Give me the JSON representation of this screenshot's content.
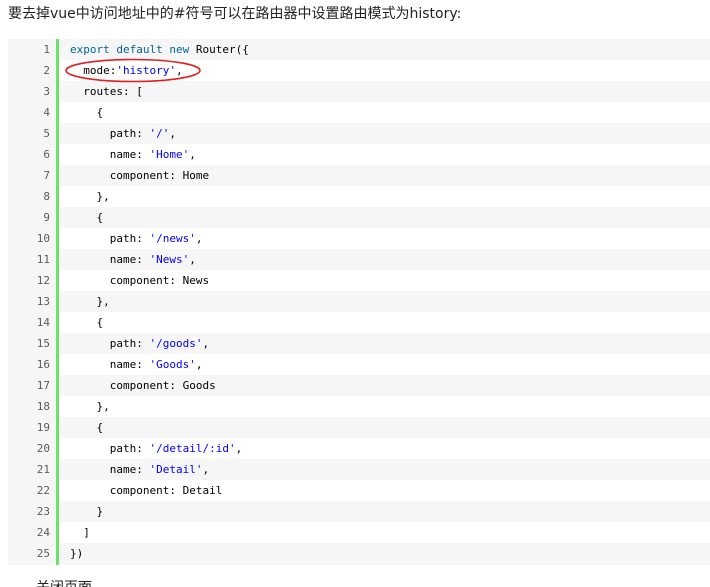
{
  "intro_text": "要去掉vue中访问地址中的#符号可以在路由器中设置路由模式为history:",
  "code_lines": [
    {
      "num": "1",
      "parts": [
        {
          "t": "export default new",
          "c": "kw"
        },
        {
          "t": " Router({",
          "c": ""
        }
      ]
    },
    {
      "num": "2",
      "parts": [
        {
          "t": "  mode:",
          "c": ""
        },
        {
          "t": "'history'",
          "c": "str"
        },
        {
          "t": ",",
          "c": ""
        }
      ]
    },
    {
      "num": "3",
      "parts": [
        {
          "t": "  routes: [",
          "c": ""
        }
      ]
    },
    {
      "num": "4",
      "parts": [
        {
          "t": "    {",
          "c": ""
        }
      ]
    },
    {
      "num": "5",
      "parts": [
        {
          "t": "      path: ",
          "c": ""
        },
        {
          "t": "'/'",
          "c": "str"
        },
        {
          "t": ",",
          "c": ""
        }
      ]
    },
    {
      "num": "6",
      "parts": [
        {
          "t": "      name: ",
          "c": ""
        },
        {
          "t": "'Home'",
          "c": "str"
        },
        {
          "t": ",",
          "c": ""
        }
      ]
    },
    {
      "num": "7",
      "parts": [
        {
          "t": "      component: Home",
          "c": ""
        }
      ]
    },
    {
      "num": "8",
      "parts": [
        {
          "t": "    },",
          "c": ""
        }
      ]
    },
    {
      "num": "9",
      "parts": [
        {
          "t": "    {",
          "c": ""
        }
      ]
    },
    {
      "num": "10",
      "parts": [
        {
          "t": "      path: ",
          "c": ""
        },
        {
          "t": "'/news'",
          "c": "str"
        },
        {
          "t": ",",
          "c": ""
        }
      ]
    },
    {
      "num": "11",
      "parts": [
        {
          "t": "      name: ",
          "c": ""
        },
        {
          "t": "'News'",
          "c": "str"
        },
        {
          "t": ",",
          "c": ""
        }
      ]
    },
    {
      "num": "12",
      "parts": [
        {
          "t": "      component: News",
          "c": ""
        }
      ]
    },
    {
      "num": "13",
      "parts": [
        {
          "t": "    },",
          "c": ""
        }
      ]
    },
    {
      "num": "14",
      "parts": [
        {
          "t": "    {",
          "c": ""
        }
      ]
    },
    {
      "num": "15",
      "parts": [
        {
          "t": "      path: ",
          "c": ""
        },
        {
          "t": "'/goods'",
          "c": "str"
        },
        {
          "t": ",",
          "c": ""
        }
      ]
    },
    {
      "num": "16",
      "parts": [
        {
          "t": "      name: ",
          "c": ""
        },
        {
          "t": "'Goods'",
          "c": "str"
        },
        {
          "t": ",",
          "c": ""
        }
      ]
    },
    {
      "num": "17",
      "parts": [
        {
          "t": "      component: Goods",
          "c": ""
        }
      ]
    },
    {
      "num": "18",
      "parts": [
        {
          "t": "    },",
          "c": ""
        }
      ]
    },
    {
      "num": "19",
      "parts": [
        {
          "t": "    {",
          "c": ""
        }
      ]
    },
    {
      "num": "20",
      "parts": [
        {
          "t": "      path: ",
          "c": ""
        },
        {
          "t": "'/detail/:id'",
          "c": "str"
        },
        {
          "t": ",",
          "c": ""
        }
      ]
    },
    {
      "num": "21",
      "parts": [
        {
          "t": "      name: ",
          "c": ""
        },
        {
          "t": "'Detail'",
          "c": "str"
        },
        {
          "t": ",",
          "c": ""
        }
      ]
    },
    {
      "num": "22",
      "parts": [
        {
          "t": "      component: Detail",
          "c": ""
        }
      ]
    },
    {
      "num": "23",
      "parts": [
        {
          "t": "    }",
          "c": ""
        }
      ]
    },
    {
      "num": "24",
      "parts": [
        {
          "t": "  ]",
          "c": ""
        }
      ]
    },
    {
      "num": "25",
      "parts": [
        {
          "t": "})",
          "c": ""
        }
      ]
    }
  ],
  "footer_text": "关闭页面",
  "colors": {
    "keyword": "#006699",
    "string": "#0000ff",
    "gutter_bar": "#6ce26c",
    "highlight_circle": "#e02020",
    "code_bg": "#f6f6f6"
  }
}
